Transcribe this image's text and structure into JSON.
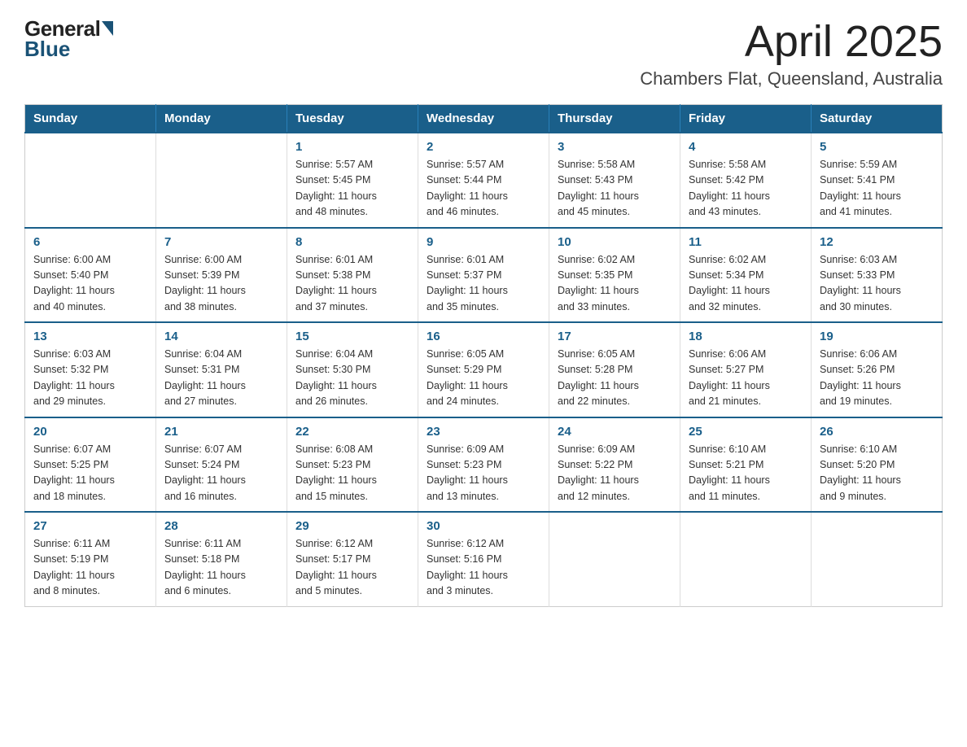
{
  "logo": {
    "general": "General",
    "blue": "Blue"
  },
  "title": "April 2025",
  "subtitle": "Chambers Flat, Queensland, Australia",
  "weekdays": [
    "Sunday",
    "Monday",
    "Tuesday",
    "Wednesday",
    "Thursday",
    "Friday",
    "Saturday"
  ],
  "weeks": [
    [
      {
        "day": null
      },
      {
        "day": null
      },
      {
        "day": 1,
        "sunrise": "5:57 AM",
        "sunset": "5:45 PM",
        "daylight": "11 hours and 48 minutes."
      },
      {
        "day": 2,
        "sunrise": "5:57 AM",
        "sunset": "5:44 PM",
        "daylight": "11 hours and 46 minutes."
      },
      {
        "day": 3,
        "sunrise": "5:58 AM",
        "sunset": "5:43 PM",
        "daylight": "11 hours and 45 minutes."
      },
      {
        "day": 4,
        "sunrise": "5:58 AM",
        "sunset": "5:42 PM",
        "daylight": "11 hours and 43 minutes."
      },
      {
        "day": 5,
        "sunrise": "5:59 AM",
        "sunset": "5:41 PM",
        "daylight": "11 hours and 41 minutes."
      }
    ],
    [
      {
        "day": 6,
        "sunrise": "6:00 AM",
        "sunset": "5:40 PM",
        "daylight": "11 hours and 40 minutes."
      },
      {
        "day": 7,
        "sunrise": "6:00 AM",
        "sunset": "5:39 PM",
        "daylight": "11 hours and 38 minutes."
      },
      {
        "day": 8,
        "sunrise": "6:01 AM",
        "sunset": "5:38 PM",
        "daylight": "11 hours and 37 minutes."
      },
      {
        "day": 9,
        "sunrise": "6:01 AM",
        "sunset": "5:37 PM",
        "daylight": "11 hours and 35 minutes."
      },
      {
        "day": 10,
        "sunrise": "6:02 AM",
        "sunset": "5:35 PM",
        "daylight": "11 hours and 33 minutes."
      },
      {
        "day": 11,
        "sunrise": "6:02 AM",
        "sunset": "5:34 PM",
        "daylight": "11 hours and 32 minutes."
      },
      {
        "day": 12,
        "sunrise": "6:03 AM",
        "sunset": "5:33 PM",
        "daylight": "11 hours and 30 minutes."
      }
    ],
    [
      {
        "day": 13,
        "sunrise": "6:03 AM",
        "sunset": "5:32 PM",
        "daylight": "11 hours and 29 minutes."
      },
      {
        "day": 14,
        "sunrise": "6:04 AM",
        "sunset": "5:31 PM",
        "daylight": "11 hours and 27 minutes."
      },
      {
        "day": 15,
        "sunrise": "6:04 AM",
        "sunset": "5:30 PM",
        "daylight": "11 hours and 26 minutes."
      },
      {
        "day": 16,
        "sunrise": "6:05 AM",
        "sunset": "5:29 PM",
        "daylight": "11 hours and 24 minutes."
      },
      {
        "day": 17,
        "sunrise": "6:05 AM",
        "sunset": "5:28 PM",
        "daylight": "11 hours and 22 minutes."
      },
      {
        "day": 18,
        "sunrise": "6:06 AM",
        "sunset": "5:27 PM",
        "daylight": "11 hours and 21 minutes."
      },
      {
        "day": 19,
        "sunrise": "6:06 AM",
        "sunset": "5:26 PM",
        "daylight": "11 hours and 19 minutes."
      }
    ],
    [
      {
        "day": 20,
        "sunrise": "6:07 AM",
        "sunset": "5:25 PM",
        "daylight": "11 hours and 18 minutes."
      },
      {
        "day": 21,
        "sunrise": "6:07 AM",
        "sunset": "5:24 PM",
        "daylight": "11 hours and 16 minutes."
      },
      {
        "day": 22,
        "sunrise": "6:08 AM",
        "sunset": "5:23 PM",
        "daylight": "11 hours and 15 minutes."
      },
      {
        "day": 23,
        "sunrise": "6:09 AM",
        "sunset": "5:23 PM",
        "daylight": "11 hours and 13 minutes."
      },
      {
        "day": 24,
        "sunrise": "6:09 AM",
        "sunset": "5:22 PM",
        "daylight": "11 hours and 12 minutes."
      },
      {
        "day": 25,
        "sunrise": "6:10 AM",
        "sunset": "5:21 PM",
        "daylight": "11 hours and 11 minutes."
      },
      {
        "day": 26,
        "sunrise": "6:10 AM",
        "sunset": "5:20 PM",
        "daylight": "11 hours and 9 minutes."
      }
    ],
    [
      {
        "day": 27,
        "sunrise": "6:11 AM",
        "sunset": "5:19 PM",
        "daylight": "11 hours and 8 minutes."
      },
      {
        "day": 28,
        "sunrise": "6:11 AM",
        "sunset": "5:18 PM",
        "daylight": "11 hours and 6 minutes."
      },
      {
        "day": 29,
        "sunrise": "6:12 AM",
        "sunset": "5:17 PM",
        "daylight": "11 hours and 5 minutes."
      },
      {
        "day": 30,
        "sunrise": "6:12 AM",
        "sunset": "5:16 PM",
        "daylight": "11 hours and 3 minutes."
      },
      {
        "day": null
      },
      {
        "day": null
      },
      {
        "day": null
      }
    ]
  ],
  "labels": {
    "sunrise": "Sunrise:",
    "sunset": "Sunset:",
    "daylight": "Daylight:"
  }
}
